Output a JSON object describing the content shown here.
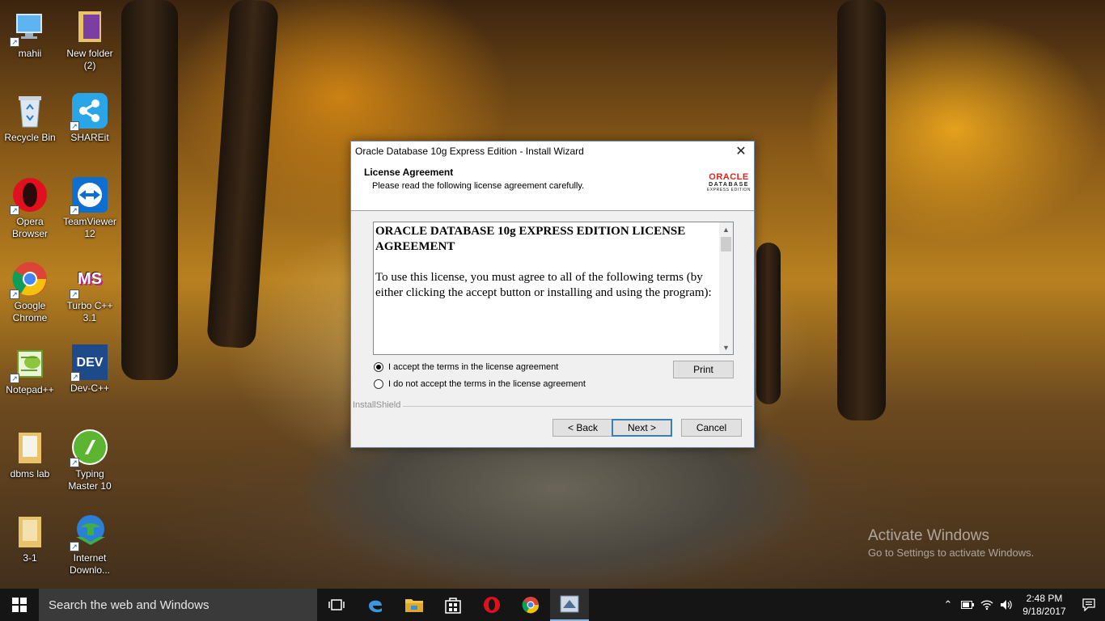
{
  "desktop": {
    "icons": [
      {
        "label": "mahii",
        "icon": "computer-icon"
      },
      {
        "label": "New folder (2)",
        "icon": "folder-icon"
      },
      {
        "label": "Recycle Bin",
        "icon": "recycle-bin-icon"
      },
      {
        "label": "SHAREit",
        "icon": "shareit-icon"
      },
      {
        "label": "Opera Browser",
        "icon": "opera-icon"
      },
      {
        "label": "TeamViewer 12",
        "icon": "teamviewer-icon"
      },
      {
        "label": "Google Chrome",
        "icon": "chrome-icon"
      },
      {
        "label": "Turbo C++ 3.1",
        "icon": "turbo-cpp-icon"
      },
      {
        "label": "Notepad++",
        "icon": "notepadpp-icon"
      },
      {
        "label": "Dev-C++",
        "icon": "devcpp-icon"
      },
      {
        "label": "dbms lab",
        "icon": "folder-icon"
      },
      {
        "label": "Typing Master 10",
        "icon": "typing-master-icon"
      },
      {
        "label": "3-1",
        "icon": "folder-icon"
      },
      {
        "label": "Internet Downlo...",
        "icon": "idm-icon"
      }
    ],
    "tile_text": {
      "ms": "MS",
      "dev": "DEV"
    }
  },
  "dialog": {
    "title": "Oracle Database 10g Express Edition - Install Wizard",
    "header_title": "License Agreement",
    "header_subtitle": "Please read the following license agreement carefully.",
    "logo": {
      "line1": "ORACLE",
      "line2": "DATABASE",
      "line3": "EXPRESS EDITION"
    },
    "license_heading": "ORACLE DATABASE 10g EXPRESS EDITION LICENSE AGREEMENT",
    "license_paragraph": "To use this license, you must agree to all of the following terms (by either clicking the accept button or installing and using the program):",
    "radio_accept": {
      "label": "I accept the terms in the license agreement",
      "selected": true
    },
    "radio_decline": {
      "label": "I do not accept the terms in the license agreement",
      "selected": false
    },
    "print_label": "Print",
    "installshield_label": "InstallShield",
    "back_label": "< Back",
    "next_label": "Next >",
    "cancel_label": "Cancel"
  },
  "watermark": {
    "line1": "Activate Windows",
    "line2": "Go to Settings to activate Windows."
  },
  "taskbar": {
    "search_placeholder": "Search the web and Windows",
    "apps": [
      "task-view-icon",
      "edge-icon",
      "file-explorer-icon",
      "store-icon",
      "opera-icon",
      "chrome-icon",
      "oracle-installer-icon"
    ],
    "time": "2:48 PM",
    "date": "9/18/2017"
  }
}
